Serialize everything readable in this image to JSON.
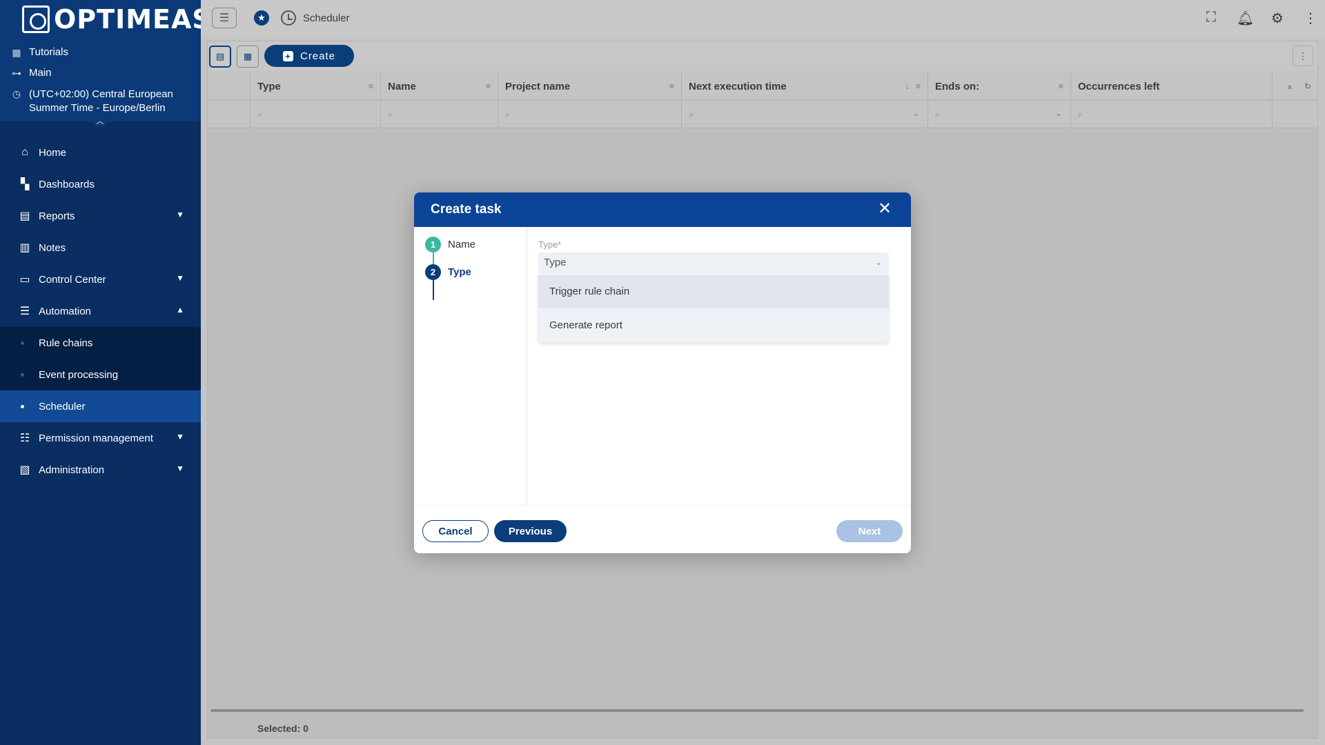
{
  "brand": {
    "logo_text": "OPTIMEAS"
  },
  "sidebar": {
    "meta": [
      {
        "icon": "building-icon",
        "text": "Tutorials"
      },
      {
        "icon": "hierarchy-icon",
        "text": "Main"
      },
      {
        "icon": "clock-icon",
        "line1": "(UTC+02:00) Central European",
        "line2": "Summer Time - Europe/Berlin"
      }
    ],
    "items": [
      {
        "label": "Home",
        "icon": "home-icon"
      },
      {
        "label": "Dashboards",
        "icon": "dashboard-icon"
      },
      {
        "label": "Reports",
        "icon": "clipboard-icon"
      },
      {
        "label": "Notes",
        "icon": "note-icon"
      },
      {
        "label": "Control Center",
        "icon": "devices-icon"
      },
      {
        "label": "Automation",
        "icon": "tune-icon"
      },
      {
        "label": "Permission management",
        "icon": "people-icon"
      },
      {
        "label": "Administration",
        "icon": "admin-icon"
      }
    ],
    "automation_sub": [
      {
        "label": "Rule chains"
      },
      {
        "label": "Event processing"
      },
      {
        "label": "Scheduler"
      }
    ]
  },
  "topbar": {
    "title": "Scheduler"
  },
  "toolbar": {
    "create_label": "Create"
  },
  "grid": {
    "columns": [
      {
        "label": "Type"
      },
      {
        "label": "Name"
      },
      {
        "label": "Project name"
      },
      {
        "label": "Next execution time"
      },
      {
        "label": "Ends on:"
      },
      {
        "label": "Occurrences left"
      }
    ],
    "selected_label": "Selected: 0"
  },
  "modal": {
    "title": "Create task",
    "steps": [
      {
        "num": "1",
        "label": "Name",
        "state": "done"
      },
      {
        "num": "2",
        "label": "Type",
        "state": "active"
      }
    ],
    "field_label": "Type*",
    "select_value": "Type",
    "options": [
      "Trigger rule chain",
      "Generate report"
    ],
    "cancel_label": "Cancel",
    "previous_label": "Previous",
    "next_label": "Next"
  },
  "colors": {
    "primary": "#0b3d7a",
    "sidebar_bg": "#0a2e61",
    "modal_header": "#0b4396",
    "step_done": "#3cb8a0",
    "next_disabled": "#a8c1e4"
  }
}
